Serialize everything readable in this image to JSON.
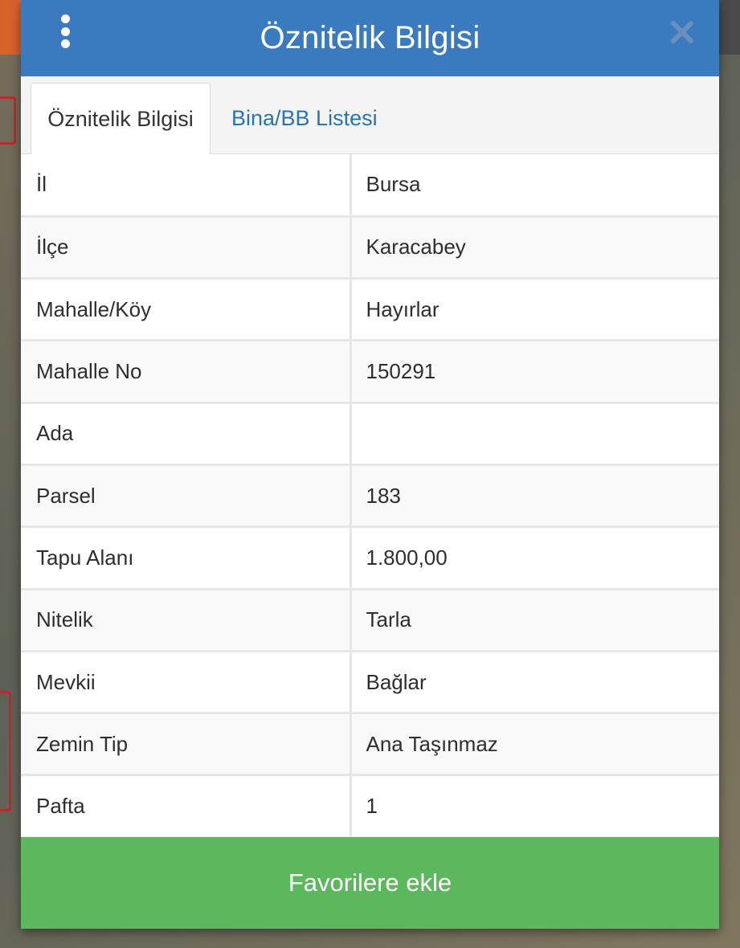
{
  "header": {
    "title": "Öznitelik Bilgisi",
    "menu_icon": "vertical-dots-icon",
    "close_icon": "close-icon"
  },
  "tabs": [
    {
      "label": "Öznitelik Bilgisi",
      "active": true
    },
    {
      "label": "Bina/BB Listesi",
      "active": false
    }
  ],
  "attributes": [
    {
      "key": "İl",
      "value": "Bursa"
    },
    {
      "key": "İlçe",
      "value": "Karacabey"
    },
    {
      "key": "Mahalle/Köy",
      "value": "Hayırlar"
    },
    {
      "key": "Mahalle No",
      "value": "150291"
    },
    {
      "key": "Ada",
      "value": ""
    },
    {
      "key": "Parsel",
      "value": "183"
    },
    {
      "key": "Tapu Alanı",
      "value": "1.800,00"
    },
    {
      "key": "Nitelik",
      "value": "Tarla"
    },
    {
      "key": "Mevkii",
      "value": "Bağlar"
    },
    {
      "key": "Zemin Tip",
      "value": "Ana Taşınmaz"
    },
    {
      "key": "Pafta",
      "value": "1"
    }
  ],
  "favorite_button": {
    "label": "Favorilere ekle"
  },
  "colors": {
    "header": "#3a7bbf",
    "tab_link": "#2a74ad",
    "button": "#5cb85c"
  }
}
